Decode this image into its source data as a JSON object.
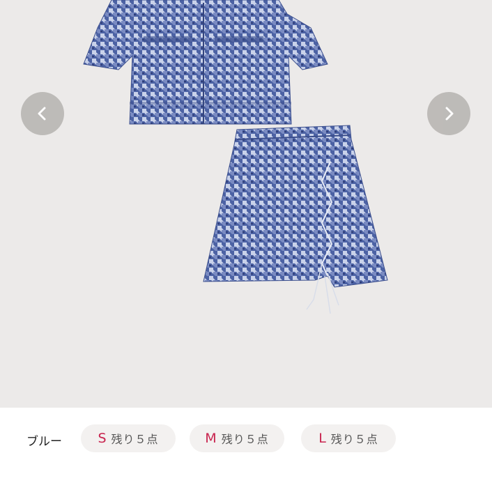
{
  "gallery": {
    "prev_icon": "chevron-left-icon",
    "next_icon": "chevron-right-icon",
    "image": "blue houndstooth cropped shirt and mini skirt set"
  },
  "variants": {
    "color_label": "ブルー",
    "sizes": [
      {
        "size": "S",
        "stock": "残り５点"
      },
      {
        "size": "M",
        "stock": "残り５点"
      },
      {
        "size": "L",
        "stock": "残り５点"
      }
    ],
    "accent_color": "#c8234e"
  }
}
